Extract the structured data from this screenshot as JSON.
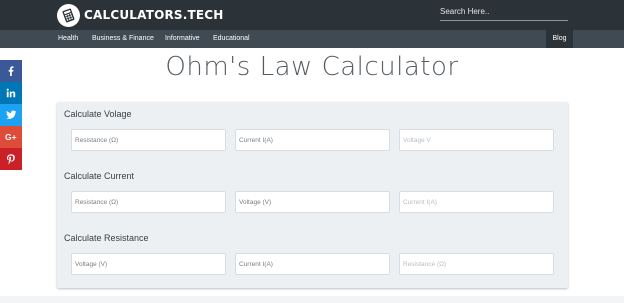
{
  "header": {
    "logo_text": "CALCULATORS.TECH",
    "logo_icon": "calculator-icon",
    "search_placeholder": "Search Here.."
  },
  "nav": {
    "items": [
      "Health",
      "Business & Finance",
      "Informative",
      "Educational"
    ],
    "blog_label": "Blog"
  },
  "social": [
    {
      "name": "facebook-icon",
      "color": "#3b5998"
    },
    {
      "name": "linkedin-icon",
      "color": "#0077b5"
    },
    {
      "name": "twitter-icon",
      "color": "#1da1f2"
    },
    {
      "name": "google-plus-icon",
      "color": "#dd4b39"
    },
    {
      "name": "pinterest-icon",
      "color": "#cb2027"
    }
  ],
  "page_title": "Ohm's Law Calculator",
  "sections": [
    {
      "title": "Calculate Volage",
      "fields": [
        {
          "placeholder": "Resistance (Ω)",
          "emphasis": "input"
        },
        {
          "placeholder": "Current I(A)",
          "emphasis": "input"
        },
        {
          "placeholder": "Voltage V",
          "emphasis": "result"
        }
      ]
    },
    {
      "title": "Calculate Current",
      "fields": [
        {
          "placeholder": "Resistance (Ω)",
          "emphasis": "input"
        },
        {
          "placeholder": "Voltage (V)",
          "emphasis": "input"
        },
        {
          "placeholder": "Current I(A)",
          "emphasis": "result"
        }
      ]
    },
    {
      "title": "Calculate Resistance",
      "fields": [
        {
          "placeholder": "Voltage (V)",
          "emphasis": "input"
        },
        {
          "placeholder": "Current I(A)",
          "emphasis": "input"
        },
        {
          "placeholder": "Resistance (Ω)",
          "emphasis": "result"
        }
      ]
    }
  ],
  "colors": {
    "topbar": "#2b3238",
    "navbar": "#3f4a52",
    "panel": "#ecf0f3"
  }
}
